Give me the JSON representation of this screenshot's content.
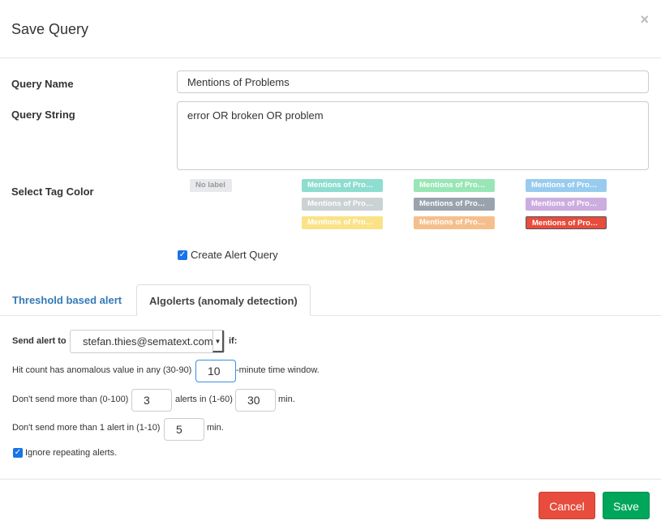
{
  "title": "Save Query",
  "close_icon": "×",
  "form": {
    "query_name_label": "Query Name",
    "query_name_value": "Mentions of Problems",
    "query_string_label": "Query String",
    "query_string_value": "error OR broken OR problem",
    "tag_color_label": "Select Tag Color",
    "no_label": "No label",
    "tag_text": "Mentions of Pro…",
    "tag_colors": [
      "#8dddd0",
      "#98e6b6",
      "#98ccee",
      "#cbd2d3",
      "#9aa3ad",
      "#cbaddf",
      "#fae286",
      "#f5bf8d",
      "#e74c3c"
    ],
    "selected_tag_color": "#e74c3c",
    "create_alert_label": "Create Alert Query",
    "create_alert_checked": true
  },
  "tabs": [
    {
      "label": "Threshold based alert",
      "active": false
    },
    {
      "label": "Algolerts (anomaly detection)",
      "active": true
    }
  ],
  "alert": {
    "send_to_label": "Send alert to",
    "send_to_value": "stefan.thies@sematext.com",
    "if_label": "if:",
    "line1_pre": "Hit count has anomalous value in any (30-90)",
    "window_value": "10",
    "line1_post": "-minute time window.",
    "line2_pre": "Don't send more than (0-100)",
    "max_alerts_value": "3",
    "line2_mid": "alerts in (1-60)",
    "alerts_period_value": "30",
    "line2_post": "min.",
    "line3_pre": "Don't send more than 1 alert in (1-10)",
    "min_interval_value": "5",
    "line3_post": "min.",
    "ignore_label": "Ignore repeating alerts.",
    "ignore_checked": true
  },
  "footer": {
    "cancel": "Cancel",
    "save": "Save",
    "cancel_color": "#e74c3c",
    "save_color": "#00a65a"
  }
}
